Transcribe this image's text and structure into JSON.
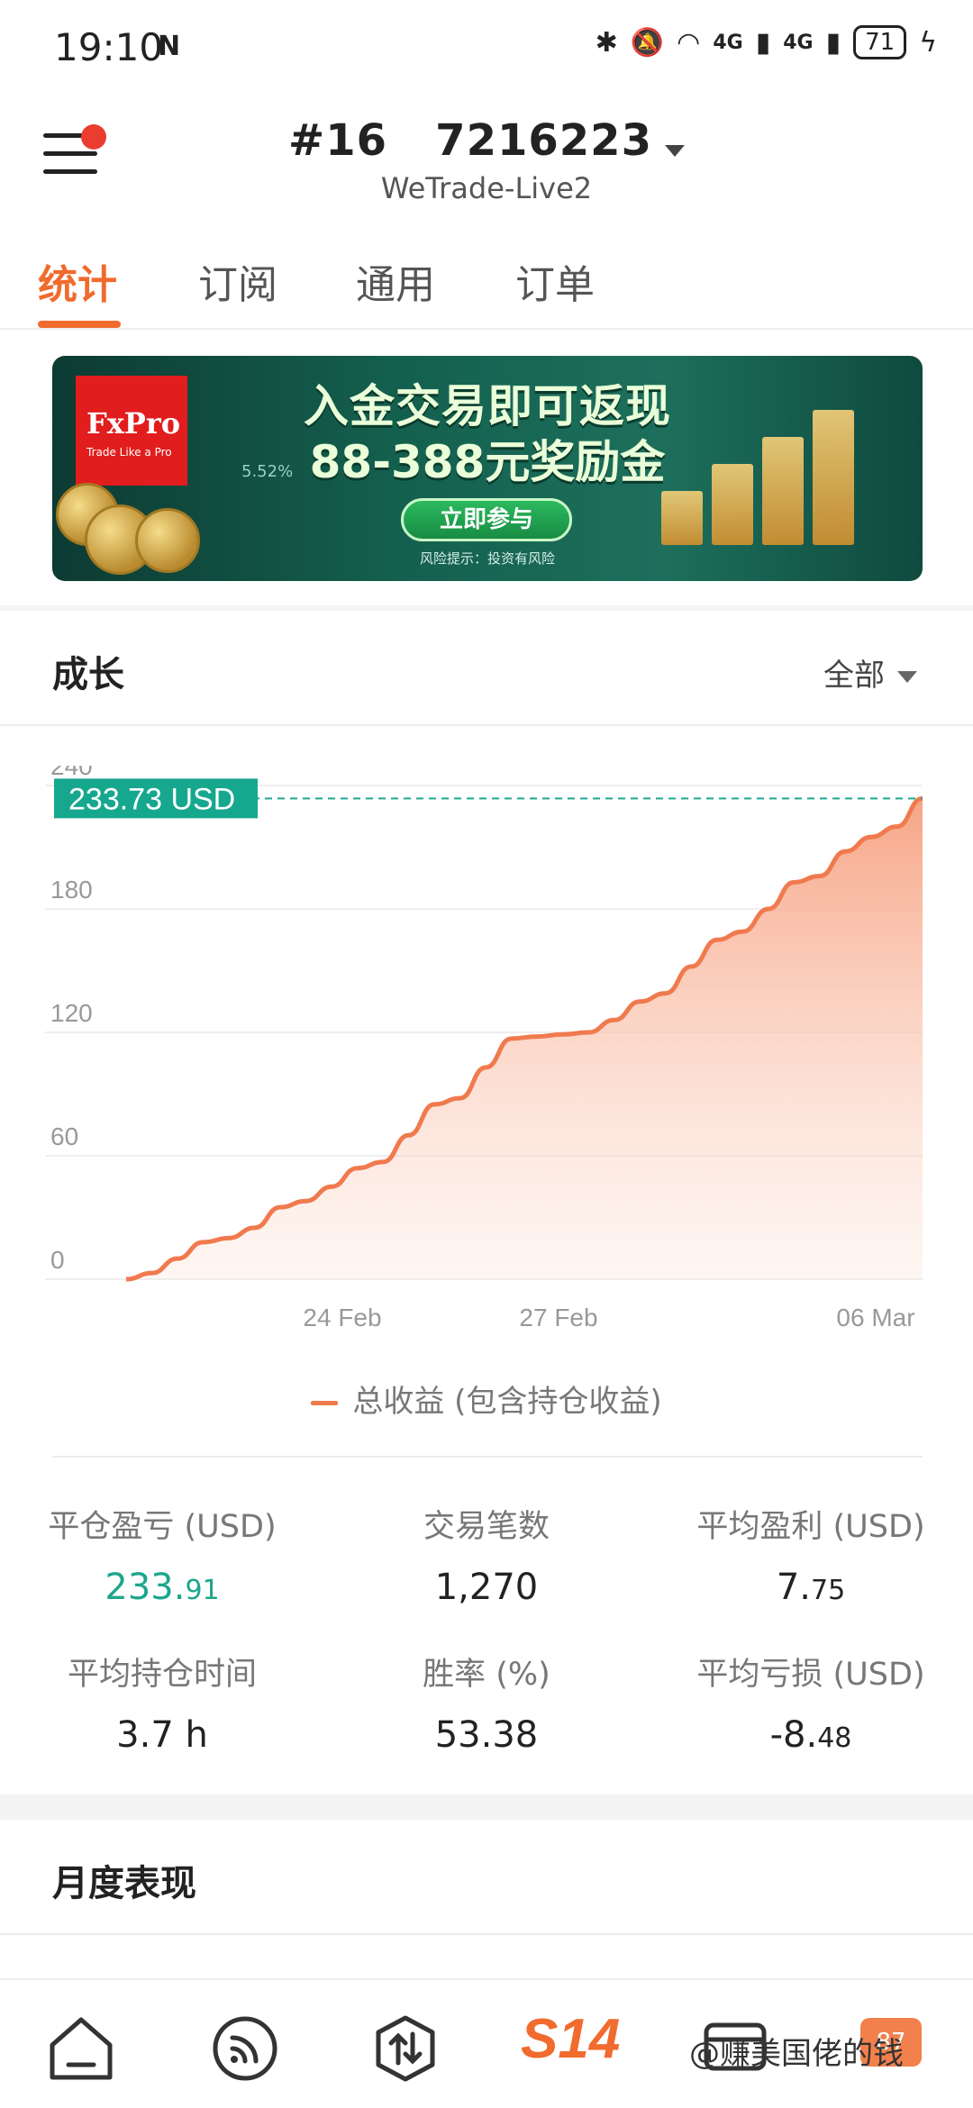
{
  "status_bar": {
    "time": "19:10",
    "nfc_icon": "N",
    "signal_1": "4G",
    "signal_2": "4G",
    "battery": "71"
  },
  "header": {
    "account_number": "#16   7216223",
    "server": "WeTrade-Live2"
  },
  "tabs": [
    {
      "label": "统计",
      "active": true
    },
    {
      "label": "订阅",
      "active": false
    },
    {
      "label": "通用",
      "active": false
    },
    {
      "label": "订单",
      "active": false
    }
  ],
  "banner": {
    "brand": "FxPro",
    "brand_tagline": "Trade Like a Pro",
    "title": "入金交易即可返现",
    "subtitle": "88-388元奖励金",
    "cta": "立即参与",
    "risk_notice": "风险提示：投资有风险",
    "small_percent": "5.52%"
  },
  "growth": {
    "title": "成长",
    "filter": "全部",
    "current_value_label": "233.73 USD",
    "legend": "总收益 (包含持仓收益)"
  },
  "chart_data": {
    "type": "area",
    "yticks": [
      "0",
      "60",
      "120",
      "180",
      "240"
    ],
    "xticks": [
      "24 Feb",
      "27 Feb",
      "06 Mar"
    ],
    "ylim": [
      0,
      240
    ],
    "series": [
      {
        "name": "总收益 (包含持仓收益)",
        "values": [
          0,
          3,
          10,
          18,
          20,
          25,
          35,
          38,
          45,
          54,
          57,
          70,
          85,
          88,
          103,
          117,
          118,
          119,
          120,
          126,
          135,
          139,
          152,
          165,
          169,
          180,
          193,
          196,
          208,
          215,
          220,
          233.73
        ]
      }
    ],
    "current_value": 233.73,
    "grid": true,
    "line_color": "#f07a4e"
  },
  "stats": [
    {
      "label": "平仓盈亏 (USD)",
      "value_main": "233.",
      "value_small": "91",
      "color": "green"
    },
    {
      "label": "交易笔数",
      "value_main": "1,270",
      "value_small": ""
    },
    {
      "label": "平均盈利 (USD)",
      "value_main": "7.",
      "value_small": "75"
    },
    {
      "label": "平均持仓时间",
      "value_main": "3.7 h",
      "value_small": ""
    },
    {
      "label": "胜率 (%)",
      "value_main": "53.38",
      "value_small": ""
    },
    {
      "label": "平均亏损 (USD)",
      "value_main": "-8.",
      "value_small": "48"
    }
  ],
  "monthly": {
    "title": "月度表现"
  },
  "bottom_nav": {
    "s14_label": "S14",
    "badge": "87",
    "watermark": "@赚美国佬的钱"
  }
}
